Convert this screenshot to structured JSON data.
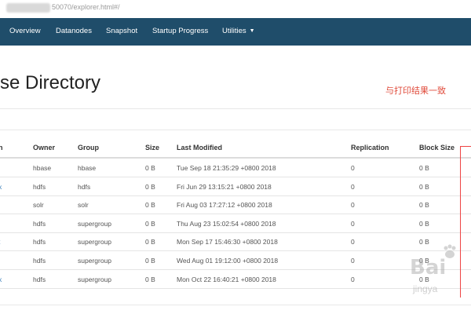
{
  "address": {
    "url": "50070/explorer.html#/"
  },
  "nav": {
    "items": [
      "Overview",
      "Datanodes",
      "Snapshot",
      "Startup Progress",
      "Utilities"
    ]
  },
  "page": {
    "title": "rse Directory",
    "annotation": "与打印结果一致"
  },
  "table": {
    "headers": [
      "n",
      "Owner",
      "Group",
      "Size",
      "Last Modified",
      "Replication",
      "Block Size"
    ],
    "rows": [
      [
        "",
        "hbase",
        "hbase",
        "0 B",
        "Tue Sep 18 21:35:29 +0800 2018",
        "0",
        "0 B"
      ],
      [
        "x",
        "hdfs",
        "hdfs",
        "0 B",
        "Fri Jun 29 13:15:21 +0800 2018",
        "0",
        "0 B"
      ],
      [
        "",
        "solr",
        "solr",
        "0 B",
        "Fri Aug 03 17:27:12 +0800 2018",
        "0",
        "0 B"
      ],
      [
        "",
        "hdfs",
        "supergroup",
        "0 B",
        "Thu Aug 23 15:02:54 +0800 2018",
        "0",
        "0 B"
      ],
      [
        "t",
        "hdfs",
        "supergroup",
        "0 B",
        "Mon Sep 17 15:46:30 +0800 2018",
        "0",
        "0 B"
      ],
      [
        "",
        "hdfs",
        "supergroup",
        "0 B",
        "Wed Aug 01 19:12:00 +0800 2018",
        "0",
        "0 B"
      ],
      [
        "x",
        "hdfs",
        "supergroup",
        "0 B",
        "Mon Oct 22 16:40:21 +0800 2018",
        "0",
        "0 B"
      ]
    ]
  },
  "watermark": {
    "brand": "Bai",
    "sub": "jingya"
  },
  "colors": {
    "nav_bg": "#1f4d6a",
    "annotation": "#e04c3c",
    "link": "#337ab7"
  }
}
